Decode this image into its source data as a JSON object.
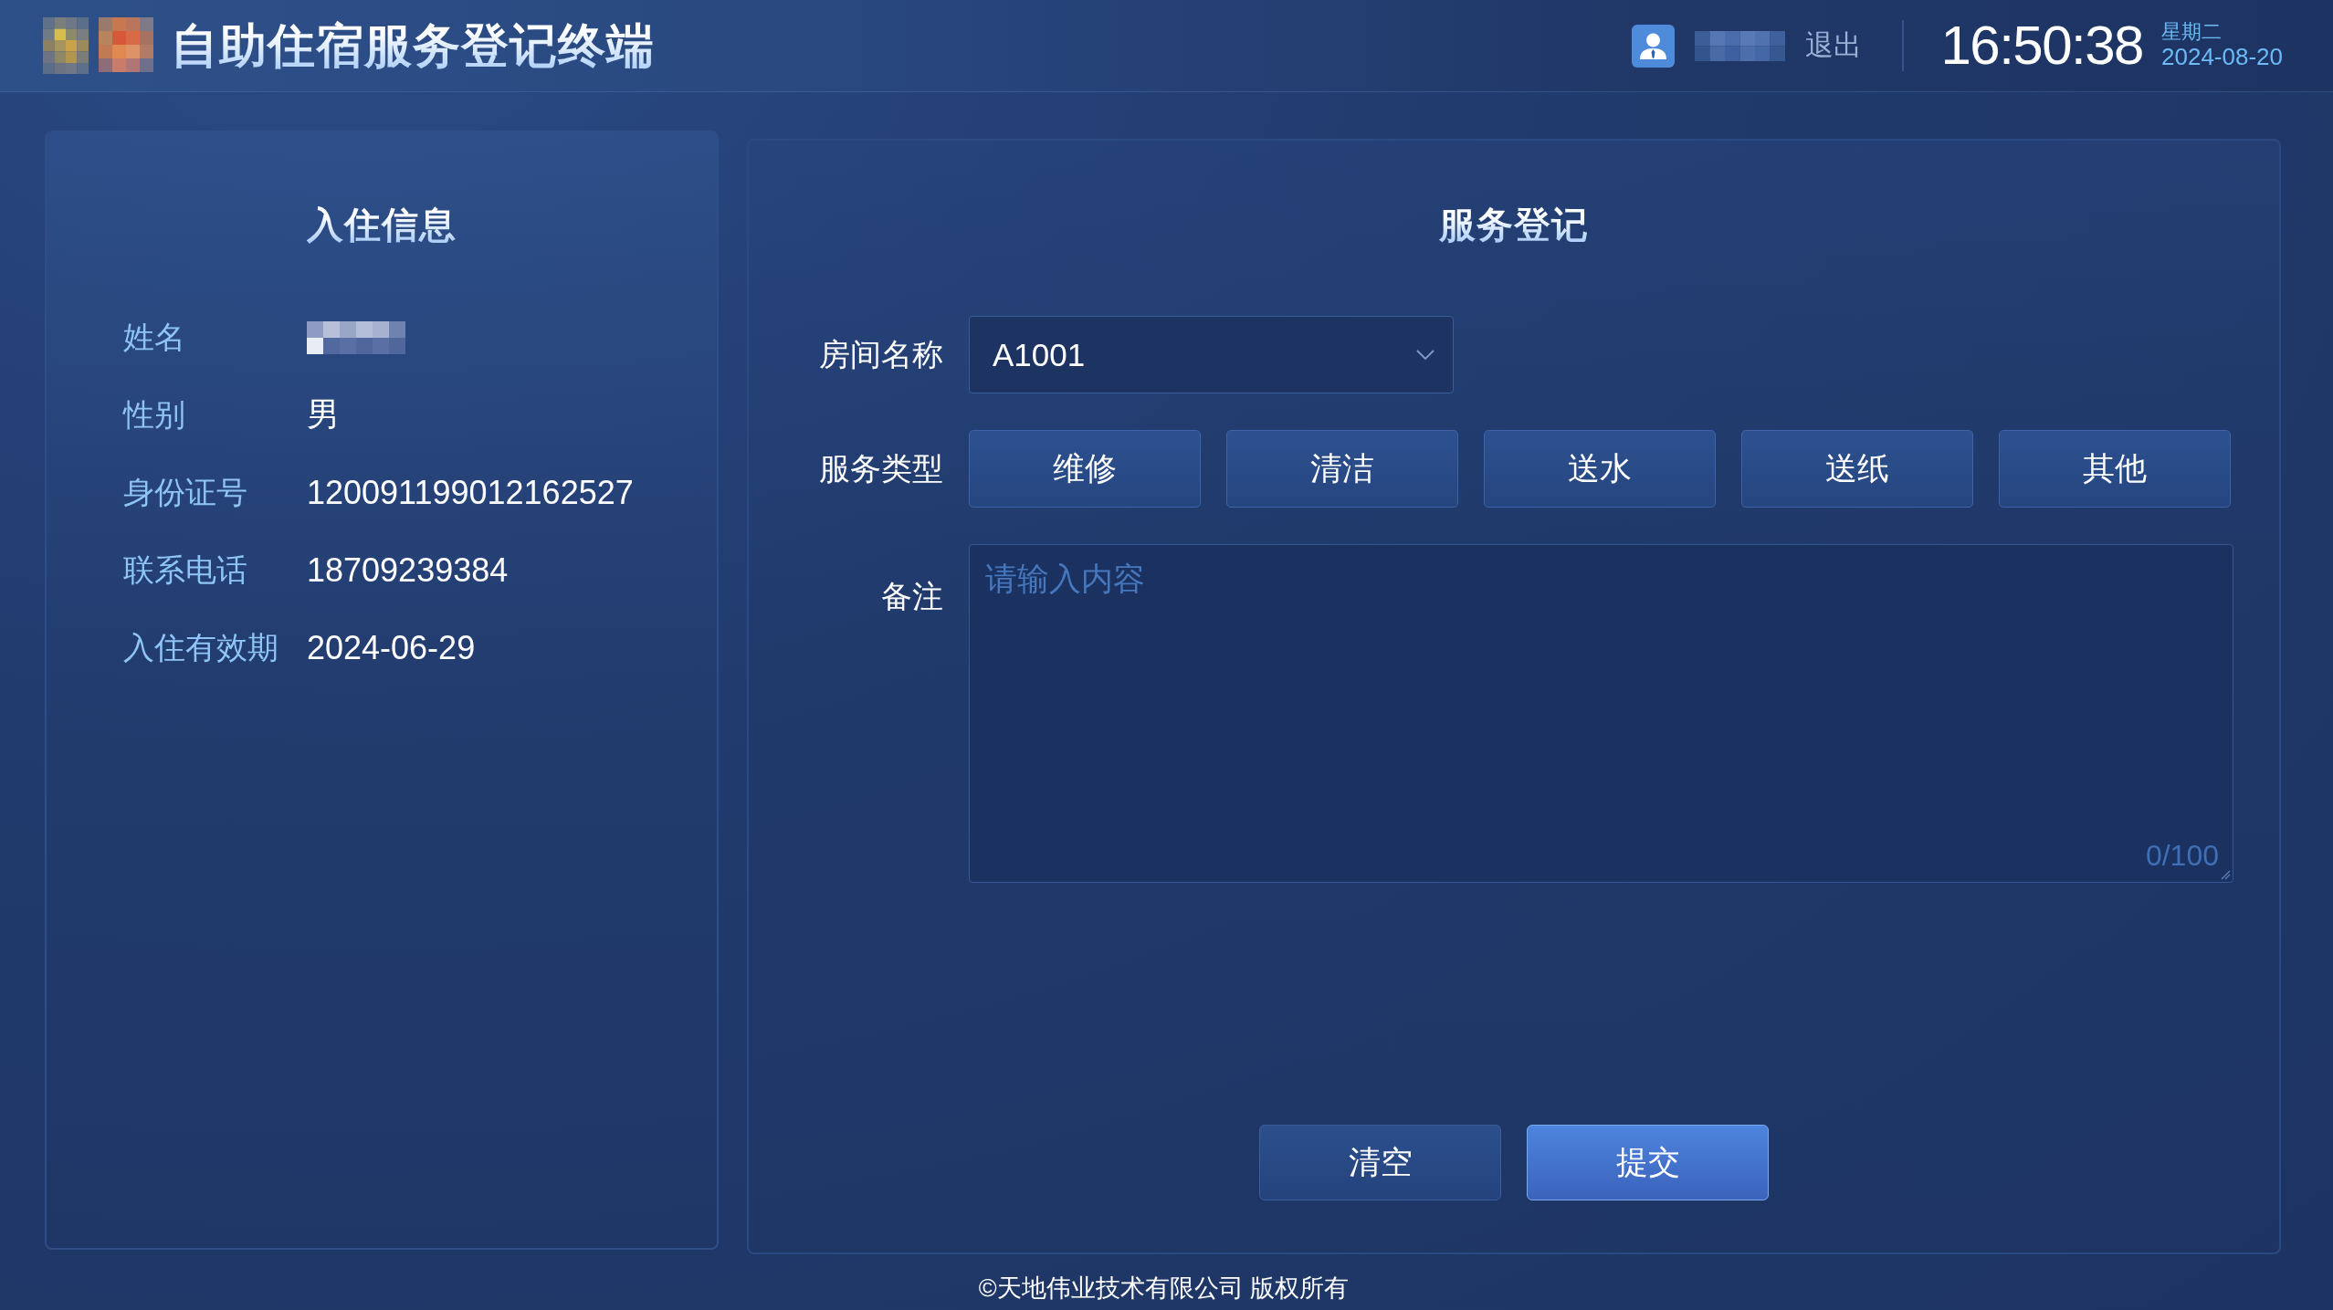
{
  "header": {
    "title": "自助住宿服务登记终端",
    "logout": "退出",
    "time": "16:50:38",
    "weekday": "星期二",
    "date": "2024-08-20"
  },
  "checkin_panel": {
    "title": "入住信息",
    "fields": [
      {
        "label": "姓名",
        "kind": "redacted"
      },
      {
        "label": "性别",
        "kind": "text",
        "value": "男"
      },
      {
        "label": "身份证号",
        "kind": "text",
        "value": "120091199012162527"
      },
      {
        "label": "联系电话",
        "kind": "text",
        "value": "18709239384"
      },
      {
        "label": "入住有效期",
        "kind": "text",
        "value": "2024-06-29"
      }
    ]
  },
  "service_panel": {
    "title": "服务登记",
    "room": {
      "label": "房间名称",
      "value": "A1001"
    },
    "service_type": {
      "label": "服务类型",
      "options": [
        {
          "label": "维修",
          "selected": false
        },
        {
          "label": "清洁",
          "selected": false
        },
        {
          "label": "送水",
          "selected": false
        },
        {
          "label": "送纸",
          "selected": false
        },
        {
          "label": "其他",
          "selected": false
        }
      ]
    },
    "remark": {
      "label": "备注",
      "placeholder": "请输入内容",
      "counter": "0/100"
    },
    "buttons": [
      {
        "label": "清空",
        "kind": "secondary"
      },
      {
        "label": "提交",
        "kind": "primary"
      }
    ]
  },
  "footer": "©天地伟业技术有限公司 版权所有"
}
